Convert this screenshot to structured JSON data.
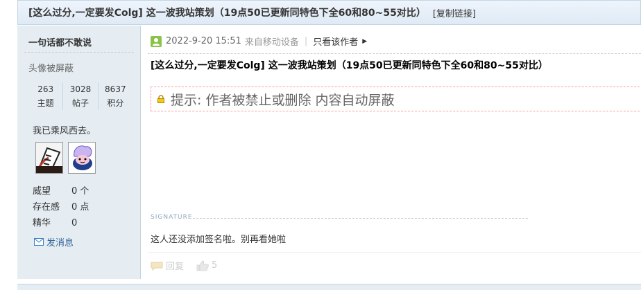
{
  "thread": {
    "title": "[这么过分,一定要发Colg] 这一波我站策划（19点50已更新同特色下全60和80~55对比）",
    "copy_link": "[复制链接]"
  },
  "user": {
    "name": "一句话都不敢说",
    "avatar_hidden": "头像被屏蔽",
    "stats": [
      {
        "value": "263",
        "label": "主题"
      },
      {
        "value": "3028",
        "label": "帖子"
      },
      {
        "value": "8637",
        "label": "积分"
      }
    ],
    "motto": "我已乘风西去。",
    "props": [
      {
        "key": "威望",
        "value": "0 个"
      },
      {
        "key": "存在感",
        "value": "0 点"
      },
      {
        "key": "精华",
        "value": "0"
      }
    ],
    "send_message": "发消息"
  },
  "post": {
    "date": "2022-9-20 15:51",
    "device": "来自移动设备",
    "only_author": "只看该作者",
    "title": "[这么过分,一定要发Colg] 这一波我站策划（19点50已更新同特色下全60和80~55对比）",
    "notice": "提示: 作者被禁止或删除 内容自动屏蔽",
    "signature_label": "SIGNATURE",
    "signature": "这人还没添加签名啦。别再看她啦",
    "reply_label": "回复",
    "like_count": "5"
  }
}
